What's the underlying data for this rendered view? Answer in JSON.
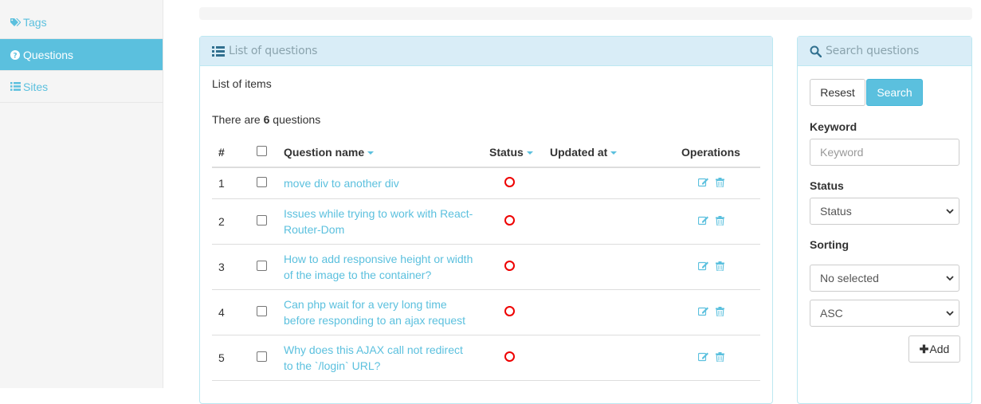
{
  "sidebar": {
    "items": [
      {
        "label": "Tags",
        "icon": "tags-icon",
        "active": false
      },
      {
        "label": "Questions",
        "icon": "question-circle-icon",
        "active": true
      },
      {
        "label": "Sites",
        "icon": "list-icon",
        "active": false
      }
    ]
  },
  "list_panel": {
    "title": "List of questions",
    "caption": "List of items",
    "count_prefix": "There are",
    "count_value": "6",
    "count_suffix": "questions",
    "columns": [
      "#",
      "",
      "Question name",
      "Status",
      "Updated at",
      "Operations"
    ],
    "rows": [
      {
        "num": "1",
        "name": "move div to another div"
      },
      {
        "num": "2",
        "name": "Issues while trying to work with React-Router-Dom"
      },
      {
        "num": "3",
        "name": "How to add responsive height or width of the image to the container?"
      },
      {
        "num": "4",
        "name": "Can php wait for a very long time before responding to an ajax request"
      },
      {
        "num": "5",
        "name": "Why does this AJAX call not redirect to the `/login` URL?"
      }
    ]
  },
  "search_panel": {
    "title": "Search questions",
    "reset_label": "Resest",
    "search_label": "Search",
    "keyword_label": "Keyword",
    "keyword_placeholder": "Keyword",
    "status_label": "Status",
    "status_value": "Status",
    "sorting_label": "Sorting",
    "sorting_value": "No selected",
    "order_value": "ASC",
    "add_label": "Add"
  },
  "colors": {
    "accent": "#5bc0de",
    "panel_head_bg": "#d9edf7",
    "panel_border": "#bce8f1",
    "status_red": "#ee0000"
  }
}
